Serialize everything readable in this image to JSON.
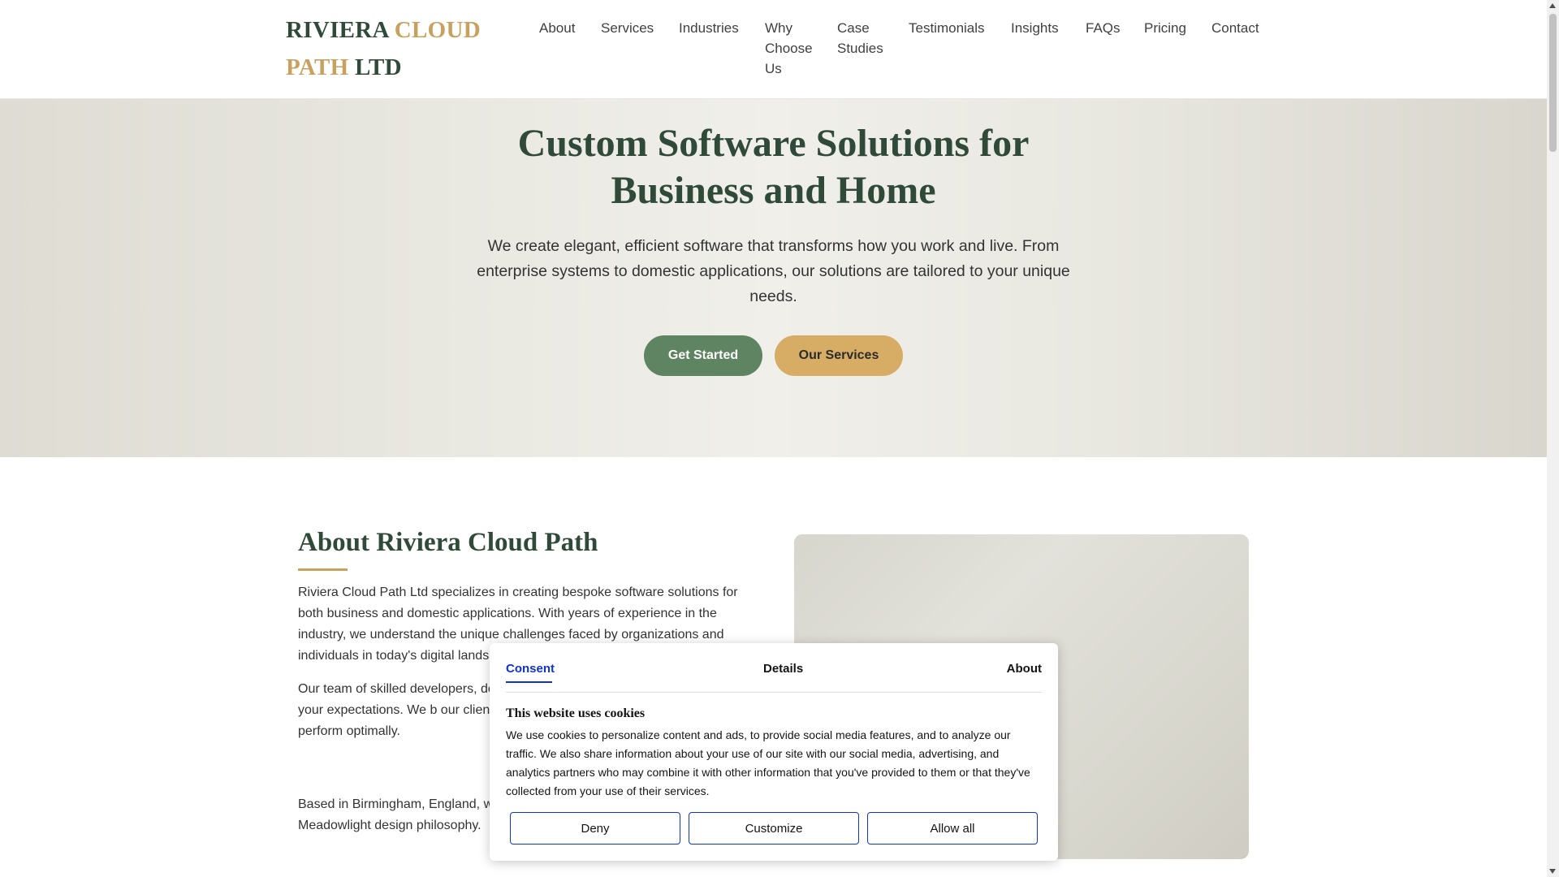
{
  "header": {
    "logo": {
      "part1": "RIVIERA",
      "part2": "CLOUD",
      "part3": "PATH",
      "part4": "LTD"
    },
    "nav": [
      {
        "label": "About"
      },
      {
        "label": "Services"
      },
      {
        "label": "Industries"
      },
      {
        "label": "Why Choose Us"
      },
      {
        "label": "Case Studies"
      },
      {
        "label": "Testimonials"
      },
      {
        "label": "Insights"
      },
      {
        "label": "FAQs"
      },
      {
        "label": "Pricing"
      },
      {
        "label": "Contact"
      }
    ]
  },
  "hero": {
    "title": "Custom Software Solutions for Business and Home",
    "text": "We create elegant, efficient software that transforms how you work and live. From enterprise systems to domestic applications, our solutions are tailored to your unique needs.",
    "primary_button": "Get Started",
    "secondary_button": "Our Services"
  },
  "about": {
    "title": "About Riviera Cloud Path",
    "p1": "Riviera Cloud Path Ltd specializes in creating bespoke software solutions for both business and domestic applications. With years of experience in the industry, we understand the unique challenges faced by organizations and individuals in today's digital lands",
    "p2": "Our team of skilled developers, de collaboratively to deliver software exceeds your expectations. We b our clients, providing ongoing sup continues to perform optimally.",
    "p3": "Based in Birmingham, England, w internationally, bringing a fresh pe Meadowlight design philosophy."
  },
  "cookie": {
    "tabs": [
      {
        "label": "Consent",
        "active": true
      },
      {
        "label": "Details",
        "active": false
      },
      {
        "label": "About",
        "active": false
      }
    ],
    "heading": "This website uses cookies",
    "text": "We use cookies to personalize content and ads, to provide social media features, and to analyze our traffic. We also share information about your use of our site with our social media, advertising, and analytics partners who may combine it with other information that you've provided to them or that they've collected from your use of their services.",
    "buttons": {
      "deny": "Deny",
      "customize": "Customize",
      "allow": "Allow all"
    }
  },
  "colors": {
    "brand_green": "#2f4a38",
    "brand_gold": "#c9a15f",
    "primary_button": "#5f8462",
    "secondary_button": "#d7ad66",
    "cookie_accent": "#1032cf"
  }
}
